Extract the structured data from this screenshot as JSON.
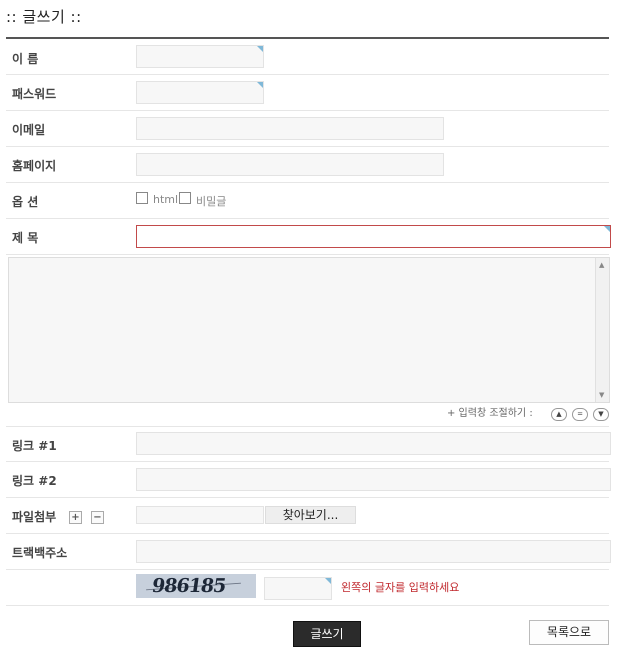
{
  "page": {
    "title": ":: 글쓰기 ::"
  },
  "form": {
    "name_label": "이 름",
    "password_label": "패스워드",
    "email_label": "이메일",
    "homepage_label": "홈페이지",
    "options_label": "옵 션",
    "option_html": "html",
    "option_secret": "비밀글",
    "subject_label": "제 목",
    "resize_label": "+ 입력창 조절하기 :",
    "link1_label": "링크 #1",
    "link2_label": "링크 #2",
    "attach_label": "파일첨부",
    "browse_label": "찾아보기...",
    "trackback_label": "트랙백주소",
    "captcha_text": "986185",
    "captcha_hint": "왼쪽의 글자를 입력하세요",
    "submit_label": "글쓰기",
    "list_label": "목록으로"
  },
  "icons": {
    "resize_up": "triangle-up-icon",
    "resize_reset": "equals-icon",
    "resize_down": "triangle-down-icon",
    "add_file": "plus-icon",
    "remove_file": "minus-icon"
  },
  "colors": {
    "submit_bg": "#2b2b2b",
    "captcha_hint": "#c0282d",
    "subject_border": "#c24a4a"
  }
}
